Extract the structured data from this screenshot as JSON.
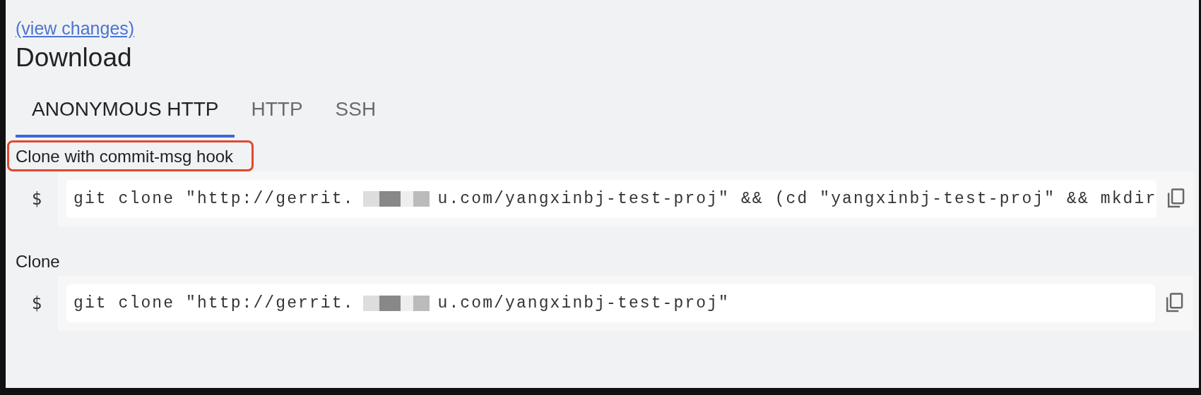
{
  "link": "(view changes)",
  "heading": "Download",
  "tabs": [
    {
      "label": "ANONYMOUS HTTP",
      "selected": true
    },
    {
      "label": "HTTP",
      "selected": false
    },
    {
      "label": "SSH",
      "selected": false
    }
  ],
  "commands": [
    {
      "label": "Clone with commit-msg hook",
      "highlighted": true,
      "prompt": "$",
      "before": "git clone \"http://gerrit.",
      "after": "u.com/yangxinbj-test-proj\" && (cd \"yangxinbj-test-proj\" && mkdir"
    },
    {
      "label": "Clone",
      "highlighted": false,
      "prompt": "$",
      "before": "git clone \"http://gerrit.",
      "after": "u.com/yangxinbj-test-proj\""
    }
  ]
}
